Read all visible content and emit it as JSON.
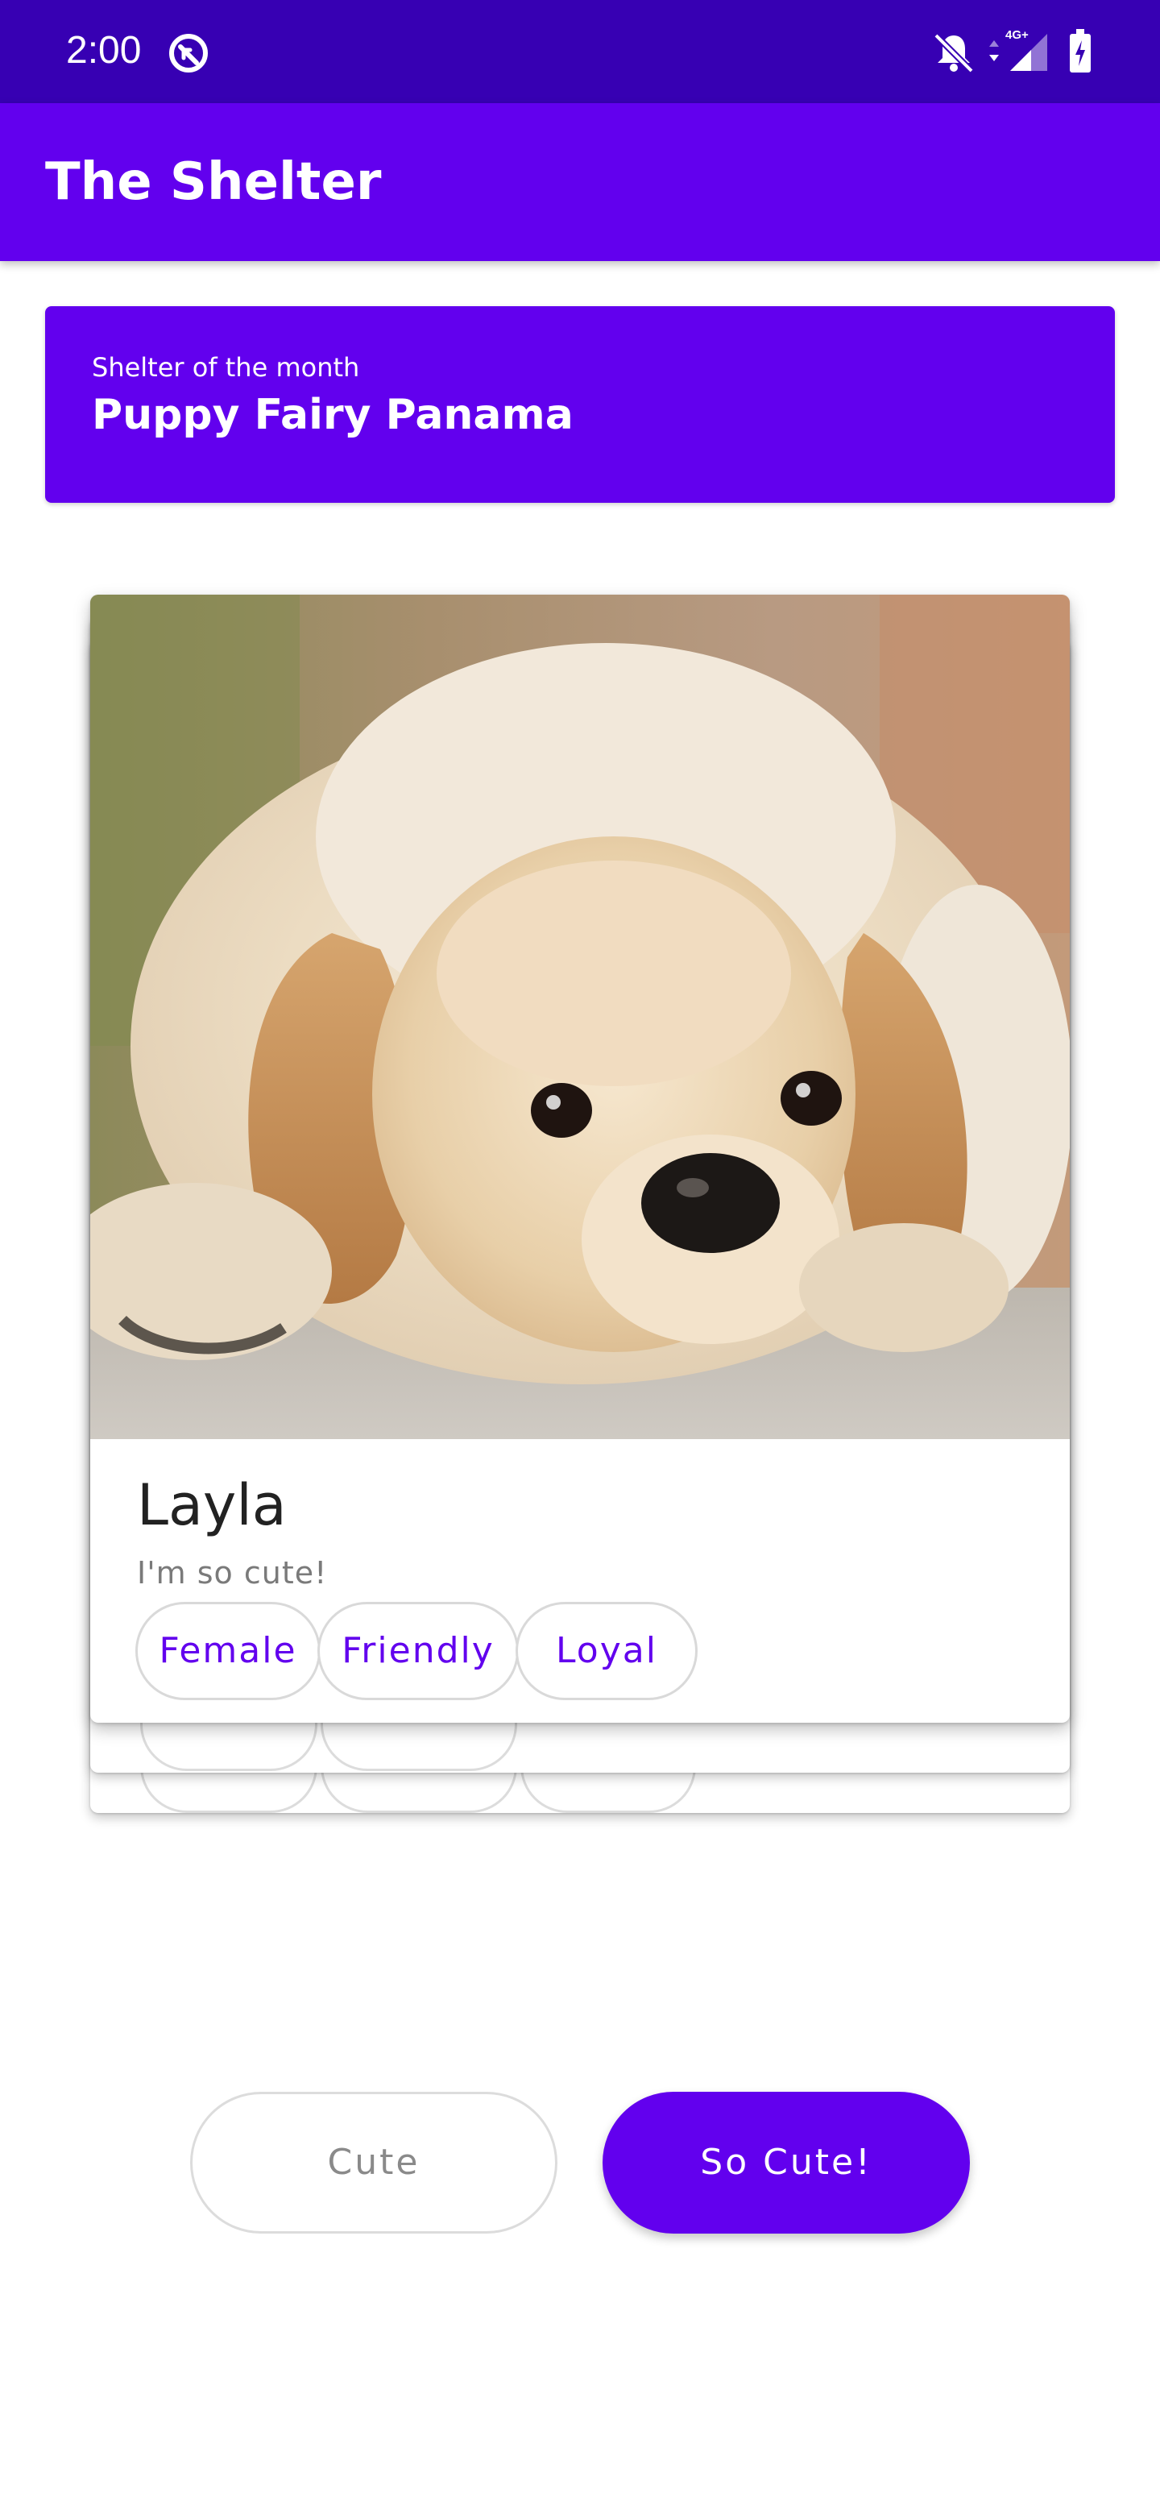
{
  "status_bar": {
    "time": "2:00",
    "icons": [
      "sync-circle-icon",
      "notifications-off-icon",
      "data-arrows-icon",
      "signal-4g-icon",
      "battery-charging-icon"
    ],
    "network_label": "4G+"
  },
  "app_bar": {
    "title": "The Shelter"
  },
  "banner": {
    "label": "Shelter of the month",
    "name": "Puppy Fairy Panama"
  },
  "card": {
    "name": "Layla",
    "tagline": "I'm so cute!",
    "tags": [
      "Female",
      "Friendly",
      "Loyal"
    ],
    "photo": "golden-retriever-puppy-photo"
  },
  "buttons": {
    "cute": "Cute",
    "so_cute": "So Cute!"
  },
  "colors": {
    "status_bar": "#3700B3",
    "primary": "#6200EE",
    "chip_text": "#6200EE",
    "chip_border": "#d9d9d9"
  }
}
